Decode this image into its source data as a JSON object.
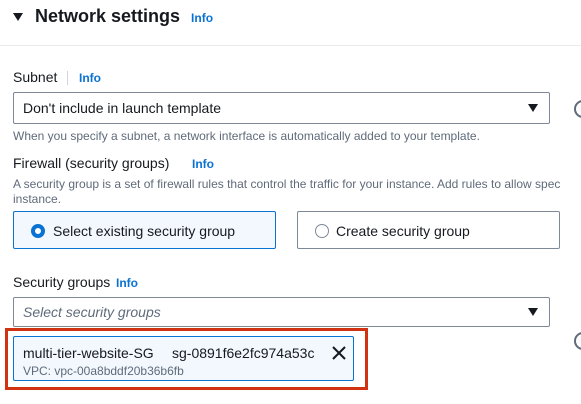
{
  "section": {
    "title": "Network settings",
    "info": "Info"
  },
  "subnet": {
    "label": "Subnet",
    "info": "Info",
    "value": "Don't include in launch template",
    "description": "When you specify a subnet, a network interface is automatically added to your template."
  },
  "firewall": {
    "label": "Firewall (security groups)",
    "info": "Info",
    "description_line1": "A security group is a set of firewall rules that control the traffic for your instance. Add rules to allow spec",
    "description_line2": "instance.",
    "options": [
      {
        "label": "Select existing security group",
        "selected": true
      },
      {
        "label": "Create security group",
        "selected": false
      }
    ]
  },
  "security_groups": {
    "label": "Security groups",
    "info": "Info",
    "placeholder": "Select security groups",
    "token": {
      "name": "multi-tier-website-SG",
      "id": "sg-0891f6e2fc974a53c",
      "vpc": "VPC: vpc-00a8bddf20b36b6fb"
    }
  },
  "colors": {
    "accent": "#0972d3",
    "highlight": "#d13212",
    "text": "#16191f",
    "muted": "#5f6b7a"
  }
}
